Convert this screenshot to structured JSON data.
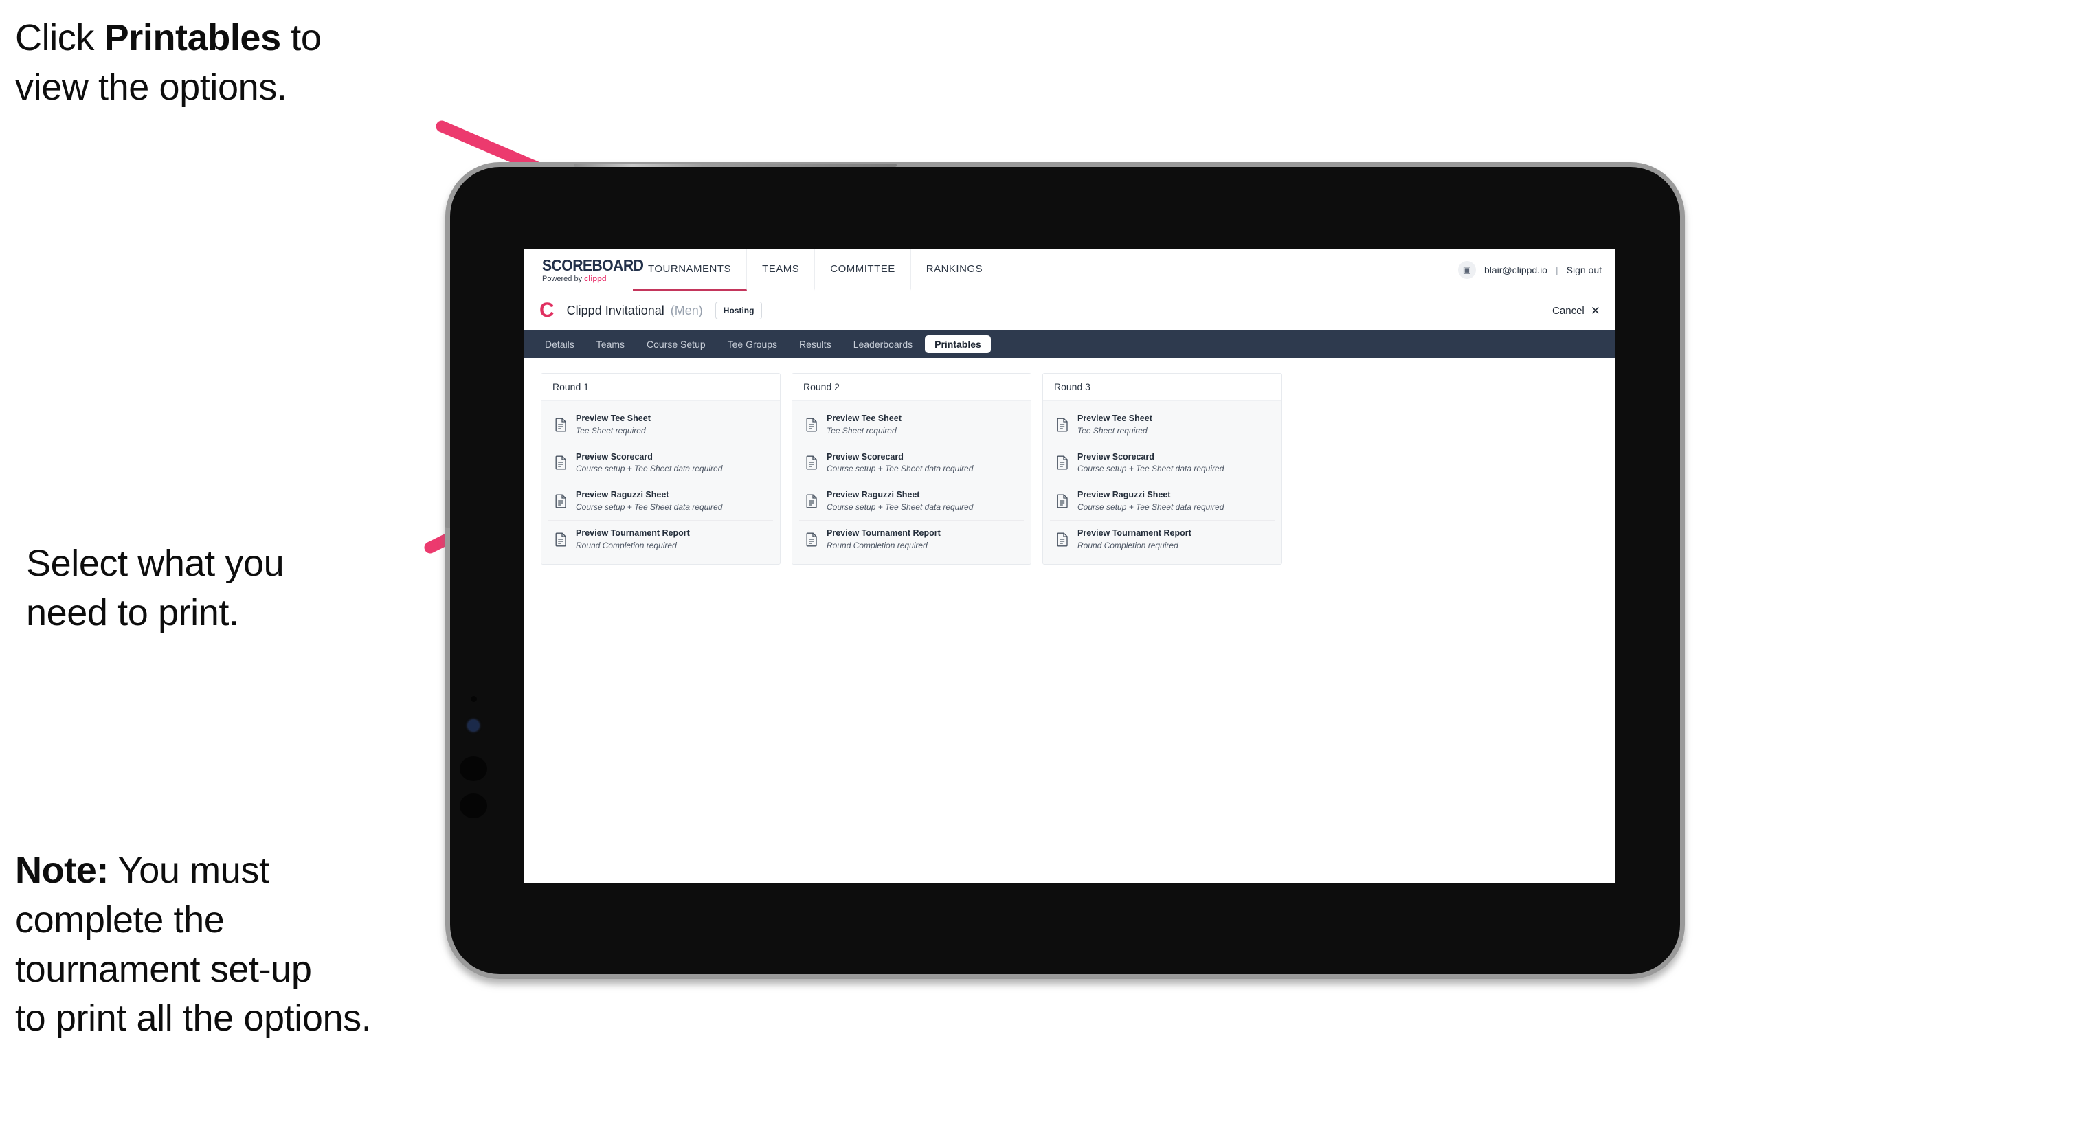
{
  "annotations": {
    "click_printables": {
      "prefix": "Click ",
      "bold": "Printables",
      "suffix": " to\nview the options."
    },
    "select_print": "Select what you\n need to print.",
    "note": {
      "bold": "Note:",
      "rest": " You must\ncomplete the\ntournament set-up\nto print all the options."
    }
  },
  "colors": {
    "accent_pink": "#e8376f",
    "arrow_pink": "#ec3a6e",
    "navy": "#2e3a4e",
    "brand_red": "#e03060",
    "tab_active_bg": "#ffffff"
  },
  "topnav": {
    "brand_title": "SCOREBOARD",
    "brand_sub_prefix": "Powered by ",
    "brand_sub_keyword": "clippd",
    "items": [
      {
        "label": "TOURNAMENTS",
        "active": true
      },
      {
        "label": "TEAMS",
        "active": false
      },
      {
        "label": "COMMITTEE",
        "active": false
      },
      {
        "label": "RANKINGS",
        "active": false
      }
    ],
    "avatar_icon": "user-avatar-icon",
    "avatar_glyph": "▣",
    "user_email": "blair@clippd.io",
    "separator": "|",
    "sign_out": "Sign out"
  },
  "tournament_bar": {
    "logo_glyph": "C",
    "name": "Clippd Invitational",
    "gender": "(Men)",
    "badge": "Hosting",
    "cancel_label": "Cancel",
    "cancel_icon_glyph": "✕"
  },
  "tabs": [
    {
      "label": "Details",
      "active": false
    },
    {
      "label": "Teams",
      "active": false
    },
    {
      "label": "Course Setup",
      "active": false
    },
    {
      "label": "Tee Groups",
      "active": false
    },
    {
      "label": "Results",
      "active": false
    },
    {
      "label": "Leaderboards",
      "active": false
    },
    {
      "label": "Printables",
      "active": true
    }
  ],
  "rounds": [
    {
      "title": "Round 1",
      "documents": [
        {
          "title": "Preview Tee Sheet",
          "subtitle": "Tee Sheet required"
        },
        {
          "title": "Preview Scorecard",
          "subtitle": "Course setup + Tee Sheet data required"
        },
        {
          "title": "Preview Raguzzi Sheet",
          "subtitle": "Course setup + Tee Sheet data required"
        },
        {
          "title": "Preview Tournament Report",
          "subtitle": "Round Completion required"
        }
      ]
    },
    {
      "title": "Round 2",
      "documents": [
        {
          "title": "Preview Tee Sheet",
          "subtitle": "Tee Sheet required"
        },
        {
          "title": "Preview Scorecard",
          "subtitle": "Course setup + Tee Sheet data required"
        },
        {
          "title": "Preview Raguzzi Sheet",
          "subtitle": "Course setup + Tee Sheet data required"
        },
        {
          "title": "Preview Tournament Report",
          "subtitle": "Round Completion required"
        }
      ]
    },
    {
      "title": "Round 3",
      "documents": [
        {
          "title": "Preview Tee Sheet",
          "subtitle": "Tee Sheet required"
        },
        {
          "title": "Preview Scorecard",
          "subtitle": "Course setup + Tee Sheet data required"
        },
        {
          "title": "Preview Raguzzi Sheet",
          "subtitle": "Course setup + Tee Sheet data required"
        },
        {
          "title": "Preview Tournament Report",
          "subtitle": "Round Completion required"
        }
      ]
    }
  ]
}
